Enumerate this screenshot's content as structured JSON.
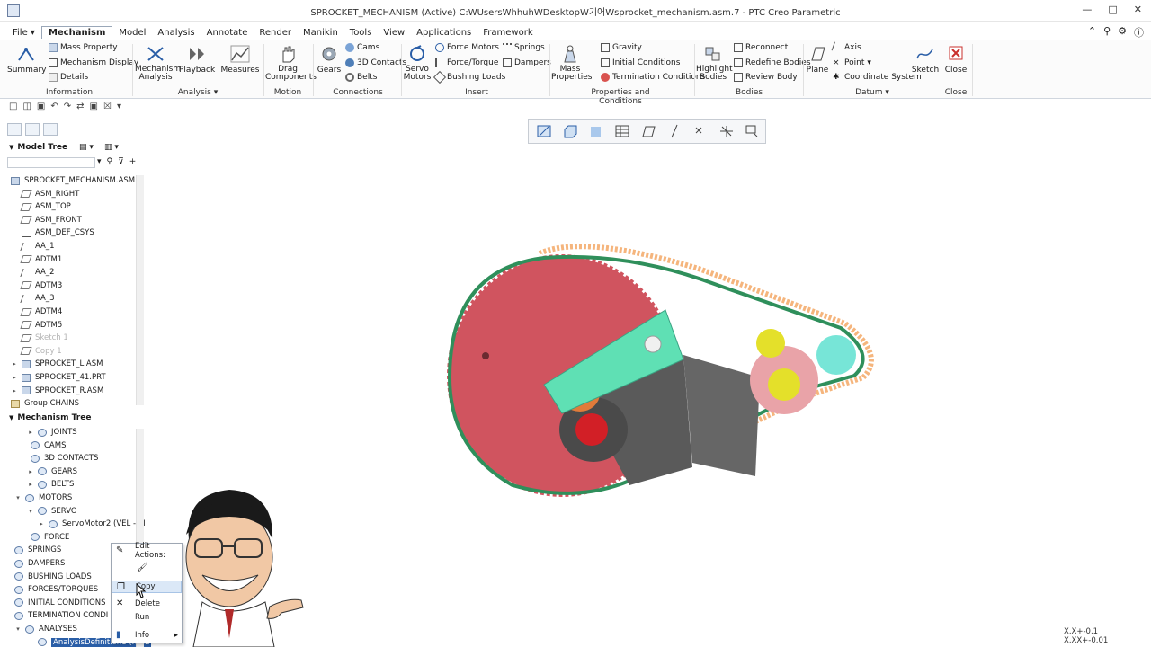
{
  "window": {
    "title": "SPROCKET_MECHANISM (Active) C:WUsersWhhuhWDesktopW기어Wsprocket_mechanism.asm.7 - PTC Creo Parametric"
  },
  "menu": {
    "file": "File",
    "tabs": [
      "Mechanism",
      "Model",
      "Analysis",
      "Annotate",
      "Render",
      "Manikin",
      "Tools",
      "View",
      "Applications",
      "Framework"
    ]
  },
  "ribbon": {
    "summary": "Summary",
    "mass_property": "Mass Property",
    "mechanism_display": "Mechanism Display",
    "details": "Details",
    "mechanism_analysis": "Mechanism Analysis",
    "playback": "Playback",
    "measures": "Measures",
    "drag_components": "Drag Components",
    "gears": "Gears",
    "cams": "Cams",
    "contacts_3d": "3D Contacts",
    "belts": "Belts",
    "servo_motors": "Servo Motors",
    "force_motors": "Force Motors",
    "force_torque": "Force/Torque",
    "bushing_loads": "Bushing Loads",
    "springs": "Springs",
    "dampers": "Dampers",
    "mass_properties": "Mass Properties",
    "gravity": "Gravity",
    "initial_conditions": "Initial Conditions",
    "termination_conditions": "Termination Conditions",
    "highlight_bodies": "Highlight Bodies",
    "reconnect": "Reconnect",
    "redefine_bodies": "Redefine Bodies",
    "review_body": "Review Body",
    "plane": "Plane",
    "axis": "Axis",
    "point": "Point",
    "coordinate_system": "Coordinate System",
    "sketch": "Sketch",
    "close": "Close",
    "groups": {
      "information": "Information",
      "analysis": "Analysis",
      "motion": "Motion",
      "connections": "Connections",
      "insert": "Insert",
      "properties_conditions": "Properties and Conditions",
      "bodies": "Bodies",
      "datum": "Datum",
      "close": "Close"
    }
  },
  "model_tree": {
    "header": "Model Tree",
    "items": [
      {
        "label": "SPROCKET_MECHANISM.ASM",
        "dim": false
      },
      {
        "label": "ASM_RIGHT",
        "dim": false
      },
      {
        "label": "ASM_TOP",
        "dim": false
      },
      {
        "label": "ASM_FRONT",
        "dim": false
      },
      {
        "label": "ASM_DEF_CSYS",
        "dim": false
      },
      {
        "label": "AA_1",
        "dim": false
      },
      {
        "label": "ADTM1",
        "dim": false
      },
      {
        "label": "AA_2",
        "dim": false
      },
      {
        "label": "ADTM3",
        "dim": false
      },
      {
        "label": "AA_3",
        "dim": false
      },
      {
        "label": "ADTM4",
        "dim": false
      },
      {
        "label": "ADTM5",
        "dim": false
      },
      {
        "label": "Sketch 1",
        "dim": true
      },
      {
        "label": "Copy 1",
        "dim": true
      },
      {
        "label": "SPROCKET_L.ASM",
        "dim": false
      },
      {
        "label": "SPROCKET_41.PRT",
        "dim": false
      },
      {
        "label": "SPROCKET_R.ASM",
        "dim": false
      },
      {
        "label": "Group CHAINS",
        "dim": false
      }
    ]
  },
  "mechanism_tree": {
    "header": "Mechanism Tree",
    "items": [
      {
        "label": "JOINTS"
      },
      {
        "label": "CAMS"
      },
      {
        "label": "3D CONTACTS"
      },
      {
        "label": "GEARS"
      },
      {
        "label": "BELTS"
      },
      {
        "label": "MOTORS"
      },
      {
        "label": "SERVO"
      },
      {
        "label": "ServoMotor2 (VEL - SI"
      },
      {
        "label": "FORCE"
      },
      {
        "label": "SPRINGS"
      },
      {
        "label": "DAMPERS"
      },
      {
        "label": "BUSHING LOADS"
      },
      {
        "label": "FORCES/TORQUES"
      },
      {
        "label": "INITIAL CONDITIONS"
      },
      {
        "label": "TERMINATION CONDI"
      },
      {
        "label": "ANALYSES"
      },
      {
        "label": "AnalysisDefinition1 (KINE"
      }
    ]
  },
  "context_menu": {
    "edit_actions": "Edit Actions:",
    "copy": "Copy",
    "delete": "Delete",
    "run": "Run",
    "info": "Info"
  },
  "readout": {
    "line1": "X.X+-0.1",
    "line2": "X.XX+-0.01"
  },
  "colors": {
    "accent": "#2a5ea7",
    "sprocket_large": "#d0545f",
    "chain": "#2f8f5b",
    "bracket": "#5fe0b4",
    "gray_body": "#5a5a5a",
    "sprocket_small": "#e9a3a8",
    "hub": "#e4e02a"
  }
}
